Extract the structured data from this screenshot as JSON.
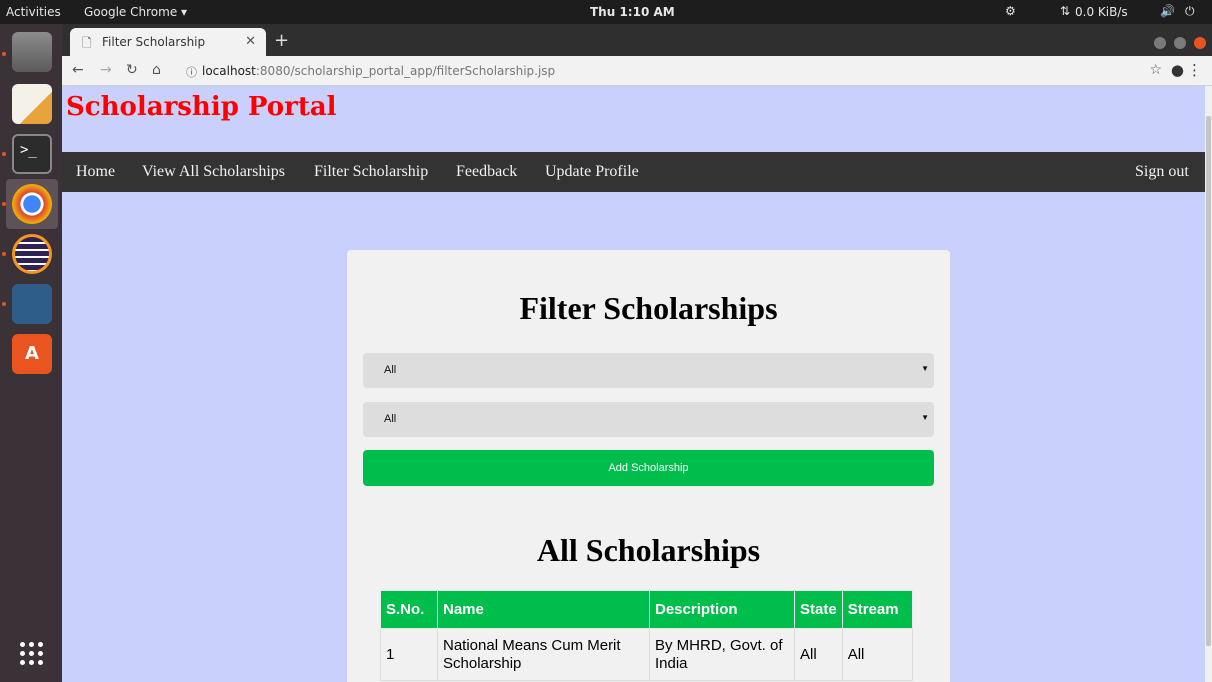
{
  "os_topbar": {
    "activities": "Activities",
    "app_menu": "Google Chrome ▾",
    "clock": "Thu  1:10 AM",
    "net_speed": "0.0 KiB/s"
  },
  "browser": {
    "tab_title": "Filter Scholarship",
    "url_host": "localhost",
    "url_path": ":8080/scholarship_portal_app/filterScholarship.jsp"
  },
  "page": {
    "portal_title": "Scholarship Portal",
    "nav": {
      "home": "Home",
      "view_all": "View All Scholarships",
      "filter": "Filter Scholarship",
      "feedback": "Feedback",
      "update_profile": "Update Profile",
      "sign_out": "Sign out"
    },
    "filter_heading": "Filter Scholarships",
    "state_select": {
      "selected": "All"
    },
    "stream_select": {
      "selected": "All"
    },
    "add_button": "Add Scholarship",
    "list_heading": "All Scholarships",
    "table": {
      "headers": [
        "S.No.",
        "Name",
        "Description",
        "State",
        "Stream"
      ],
      "rows": [
        [
          "1",
          "National Means Cum Merit Scholarship",
          "By MHRD, Govt. of India",
          "All",
          "All"
        ]
      ]
    }
  },
  "colors": {
    "portal_title": "#ff0000",
    "page_bg": "#c8d0fb",
    "navbar_bg": "#333333",
    "accent_green": "#00be4c"
  }
}
